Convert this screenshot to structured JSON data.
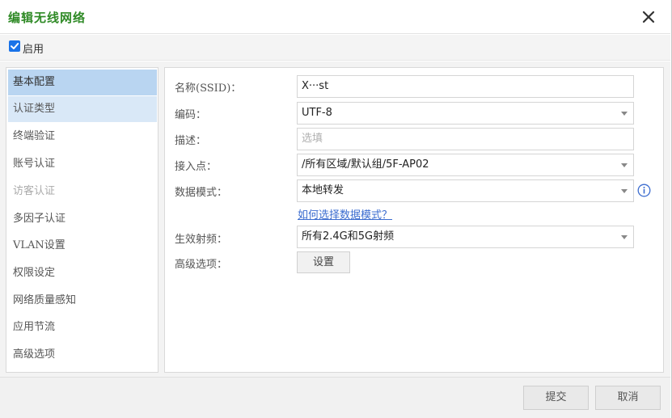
{
  "dialog": {
    "title": "编辑无线网络",
    "enable_label": "启用",
    "enable_checked": true
  },
  "sidebar": {
    "items": [
      {
        "label": "基本配置",
        "state": "active"
      },
      {
        "label": "认证类型",
        "state": "hover"
      },
      {
        "label": "终端验证",
        "state": "normal"
      },
      {
        "label": "账号认证",
        "state": "normal"
      },
      {
        "label": "访客认证",
        "state": "disabled"
      },
      {
        "label": "多因子认证",
        "state": "normal"
      },
      {
        "label": "VLAN设置",
        "state": "normal"
      },
      {
        "label": "权限设定",
        "state": "normal"
      },
      {
        "label": "网络质量感知",
        "state": "normal"
      },
      {
        "label": "应用节流",
        "state": "normal"
      },
      {
        "label": "高级选项",
        "state": "normal"
      }
    ]
  },
  "form": {
    "ssid_label": "名称(SSID)：",
    "ssid_value": "X···st",
    "encoding_label": "编码：",
    "encoding_value": "UTF-8",
    "desc_label": "描述：",
    "desc_placeholder": "选填",
    "ap_label": "接入点：",
    "ap_value": "/所有区域/默认组/5F-AP02",
    "mode_label": "数据模式：",
    "mode_value": "本地转发",
    "mode_help": "如何选择数据模式？",
    "radio_label": "生效射频：",
    "radio_value": "所有2.4G和5G射频",
    "advanced_label": "高级选项：",
    "advanced_button": "设置"
  },
  "footer": {
    "submit_label": "提交",
    "cancel_label": "取消"
  },
  "colors": {
    "title": "#2f8a26",
    "active_tab": "#b9d5f1",
    "link": "#3b6ccf",
    "checkbox": "#1a73e8"
  }
}
